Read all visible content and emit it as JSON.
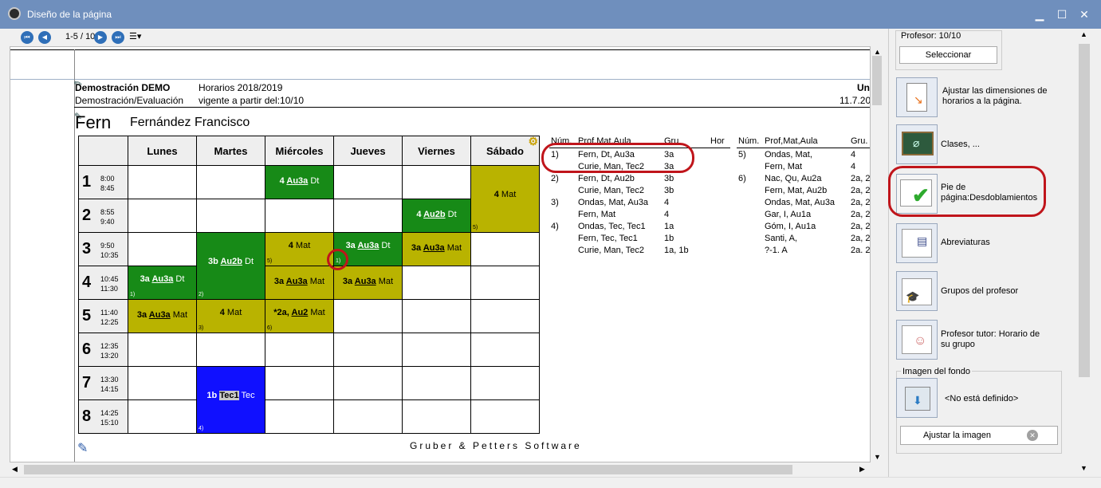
{
  "window": {
    "title": "Diseño de la página",
    "min": "▁",
    "max": "☐",
    "close": "✕"
  },
  "toolbar": {
    "page_indicator": "1-5 / 10"
  },
  "header": {
    "school": "Demostración DEMO",
    "sub": "Demostración/Evaluación",
    "year": "Horarios 2018/2019",
    "valid": "vigente a partir del:10/10",
    "right1": "Un",
    "right2": "11.7.20"
  },
  "teacher": {
    "code": "Fern",
    "name": "Fernández Francisco"
  },
  "days": [
    "Lunes",
    "Martes",
    "Miércoles",
    "Jueves",
    "Viernes",
    "Sábado"
  ],
  "periods": [
    {
      "n": "1",
      "t1": "8:00",
      "t2": "8:45"
    },
    {
      "n": "2",
      "t1": "8:55",
      "t2": "9:40"
    },
    {
      "n": "3",
      "t1": "9:50",
      "t2": "10:35"
    },
    {
      "n": "4",
      "t1": "10:45",
      "t2": "11:30"
    },
    {
      "n": "5",
      "t1": "11:40",
      "t2": "12:25"
    },
    {
      "n": "6",
      "t1": "12:35",
      "t2": "13:20"
    },
    {
      "n": "7",
      "t1": "13:30",
      "t2": "14:15"
    },
    {
      "n": "8",
      "t1": "14:25",
      "t2": "15:10"
    }
  ],
  "lessons": {
    "mie1": {
      "a": "4 ",
      "b": "Au3a",
      "c": " Dt"
    },
    "sab12": {
      "a": "4 ",
      "b": "",
      "c": "Mat",
      "n": "5)"
    },
    "vie2": {
      "a": "4 ",
      "b": "Au2b",
      "c": " Dt"
    },
    "mar34": {
      "a": "3b ",
      "b": "Au2b",
      "c": " Dt",
      "n": "2)"
    },
    "mie3": {
      "a": "4 ",
      "b": "",
      "c": "Mat",
      "n": "5)"
    },
    "jue3": {
      "a": "3a ",
      "b": "Au3a",
      "c": " Dt",
      "n": "1)"
    },
    "vie3": {
      "a": "3a ",
      "b": "Au3a",
      "c": " Mat"
    },
    "lun4": {
      "a": "3a ",
      "b": "Au3a",
      "c": " Dt",
      "n": "1)"
    },
    "mie4": {
      "a": "3a ",
      "b": "Au3a",
      "c": " Mat"
    },
    "jue4": {
      "a": "3a ",
      "b": "Au3a",
      "c": " Mat"
    },
    "lun5": {
      "a": "3a ",
      "b": "Au3a",
      "c": " Mat"
    },
    "mar5": {
      "a": "4 ",
      "b": "",
      "c": "Mat",
      "n": "3)"
    },
    "mie5": {
      "a": "*2a, ",
      "b": "Au2",
      "c": " Mat",
      "n": "6)"
    },
    "mar78": {
      "a": "1b ",
      "b": "Tec1",
      "c": " Tec",
      "n": "4)"
    }
  },
  "footer_brand": "Gruber & Petters Software",
  "list_headers": {
    "num": "Núm.",
    "prof": "Prof,Mat,Aula",
    "gru": "Gru",
    "hor": "Hor",
    "num2": "Núm.",
    "prof2": "Prof,Mat,Aula",
    "gru2": "Gru."
  },
  "list1": [
    {
      "num": "1)",
      "prof": "Fern, Dt,  Au3a",
      "gru": "3a"
    },
    {
      "num": "",
      "prof": "Curie, Man,  Tec2",
      "gru": "3a"
    },
    {
      "num": "2)",
      "prof": "Fern, Dt,  Au2b",
      "gru": "3b"
    },
    {
      "num": "",
      "prof": "Curie, Man,  Tec2",
      "gru": "3b"
    },
    {
      "num": "3)",
      "prof": "Ondas, Mat,  Au3a",
      "gru": "4"
    },
    {
      "num": "",
      "prof": "Fern, Mat",
      "gru": "4"
    },
    {
      "num": "4)",
      "prof": "Ondas, Tec,  Tec1",
      "gru": "1a"
    },
    {
      "num": "",
      "prof": "Fern, Tec,  Tec1",
      "gru": "1b"
    },
    {
      "num": "",
      "prof": "Curie, Man,  Tec2",
      "gru": "1a, 1b"
    }
  ],
  "list2": [
    {
      "num": "5)",
      "prof": "Ondas, Mat,",
      "gru": "4"
    },
    {
      "num": "",
      "prof": "Fern, Mat",
      "gru": "4"
    },
    {
      "num": "6)",
      "prof": "Nac, Qu,  Au2a",
      "gru": "2a, 2"
    },
    {
      "num": "",
      "prof": "Fern, Mat,  Au2b",
      "gru": "2a, 2"
    },
    {
      "num": "",
      "prof": "Ondas, Mat,  Au3a",
      "gru": "2a, 2"
    },
    {
      "num": "",
      "prof": "Gar, I,  Au1a",
      "gru": "2a, 2"
    },
    {
      "num": "",
      "prof": "Góm, I,  Au1a",
      "gru": "2a, 2"
    },
    {
      "num": "",
      "prof": "Santi, A,",
      "gru": "2a, 2"
    },
    {
      "num": "",
      "prof": "?-1. A",
      "gru": "2a. 2"
    }
  ],
  "panel": {
    "profesor": "Profesor: 10/10",
    "select_btn": "Seleccionar",
    "items": [
      "Ajustar las dimensiones de horarios a la página.",
      "Clases, ...",
      "Pie de página:Desdoblamientos",
      "Abreviaturas",
      "Grupos del profesor",
      "Profesor tutor: Horario de su grupo"
    ],
    "bg_label": "Imagen del fondo",
    "bg_value": "<No está definido>",
    "adjust_btn": "Ajustar la imagen"
  },
  "colors": {
    "dark_green": "#178a17",
    "olive": "#b9b300",
    "blue": "#1010ff",
    "highlight_red": "#c0151b",
    "title_bar": "#6f8fbd"
  }
}
